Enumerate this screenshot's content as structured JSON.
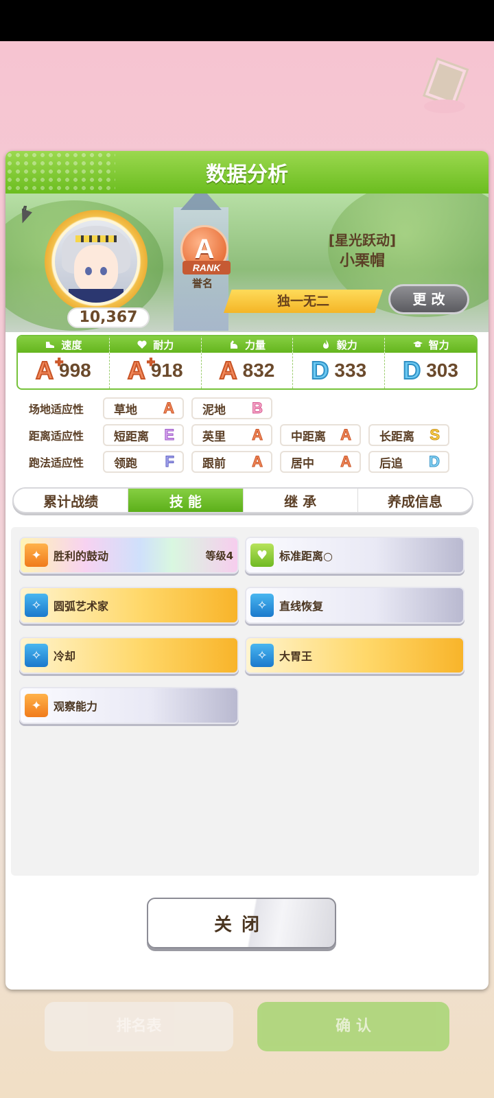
{
  "modal": {
    "title": "数据分析"
  },
  "profile": {
    "fans": "10,367",
    "rank_letter": "A",
    "rank_ribbon": "RANK",
    "rank_caption": "誉名",
    "title": "[星光跃动]",
    "name": "小栗帽",
    "epithet": "独一无二",
    "change_label": "更 改"
  },
  "stats": [
    {
      "label": "速度",
      "icon": "shoe-icon",
      "grade": "A",
      "plus": "+",
      "value": "998"
    },
    {
      "label": "耐力",
      "icon": "heart-icon",
      "grade": "A",
      "plus": "+",
      "value": "918"
    },
    {
      "label": "力量",
      "icon": "muscle-icon",
      "grade": "A",
      "plus": "",
      "value": "832"
    },
    {
      "label": "毅力",
      "icon": "fire-icon",
      "grade": "D",
      "plus": "",
      "value": "333"
    },
    {
      "label": "智力",
      "icon": "graduation-cap-icon",
      "grade": "D",
      "plus": "",
      "value": "303"
    }
  ],
  "aptitude": {
    "track": {
      "label": "场地适应性",
      "items": [
        {
          "name": "草地",
          "grade": "A"
        },
        {
          "name": "泥地",
          "grade": "B"
        }
      ]
    },
    "distance": {
      "label": "距离适应性",
      "items": [
        {
          "name": "短距离",
          "grade": "E"
        },
        {
          "name": "英里",
          "grade": "A"
        },
        {
          "name": "中距离",
          "grade": "A"
        },
        {
          "name": "长距离",
          "grade": "S"
        }
      ]
    },
    "style": {
      "label": "跑法适应性",
      "items": [
        {
          "name": "领跑",
          "grade": "F"
        },
        {
          "name": "跟前",
          "grade": "A"
        },
        {
          "name": "居中",
          "grade": "A"
        },
        {
          "name": "后追",
          "grade": "D"
        }
      ]
    }
  },
  "tabs": [
    "累计战绩",
    "技 能",
    "继 承",
    "养成信息"
  ],
  "active_tab": 1,
  "skills": [
    {
      "name": "胜利的鼓动",
      "level": "等级4",
      "style": "rainbow",
      "icon": "orange"
    },
    {
      "name": "标准距离○",
      "level": "",
      "style": "white",
      "icon": "green"
    },
    {
      "name": "圆弧艺术家",
      "level": "",
      "style": "gold",
      "icon": "blue"
    },
    {
      "name": "直线恢复",
      "level": "",
      "style": "white",
      "icon": "blue"
    },
    {
      "name": "冷却",
      "level": "",
      "style": "gold",
      "icon": "blue"
    },
    {
      "name": "大胃王",
      "level": "",
      "style": "gold",
      "icon": "blue"
    },
    {
      "name": "观察能力",
      "level": "",
      "style": "white",
      "icon": "orange"
    }
  ],
  "close_label": "关闭",
  "background": {
    "left_button": "排名表",
    "right_button": "确 认"
  }
}
